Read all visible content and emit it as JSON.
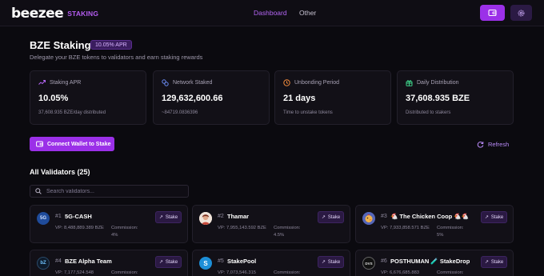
{
  "header": {
    "logo_text": "beezee",
    "logo_tag": "STAKING",
    "nav": [
      "Dashboard",
      "Other"
    ],
    "accent_color": "#9b30e8",
    "wallet_icon": "wallet-icon",
    "settings_icon": "gear-icon"
  },
  "page": {
    "title": "BZE Staking",
    "apr_badge": "10.05% APR",
    "subtitle": "Delegate your BZE tokens to validators and earn staking rewards"
  },
  "stats": [
    {
      "icon": "trending-up-icon",
      "label": "Staking APR",
      "value": "10.05%",
      "foot": "37,608.935 BZE/day distributed"
    },
    {
      "icon": "network-icon",
      "label": "Network Staked",
      "value": "129,632,600.66",
      "foot": "~84719.0836396"
    },
    {
      "icon": "clock-icon",
      "label": "Unbonding Period",
      "value": "21 days",
      "foot": "Time to unstake tokens"
    },
    {
      "icon": "gift-icon",
      "label": "Daily Distribution",
      "value": "37,608.935 BZE",
      "foot": "Distributed to stakers"
    }
  ],
  "actions": {
    "connect_label": "Connect Wallet to Stake",
    "refresh_label": "Refresh"
  },
  "validators": {
    "heading": "All Validators (25)",
    "search_placeholder": "Search validators...",
    "stake_label": "Stake",
    "items": [
      {
        "rank": "#1",
        "name": "5G-CASH",
        "vp": "VP: 8,488,889.389 BZE",
        "commission_label": "Commission:",
        "commission": "4%",
        "avatar_text": "5G"
      },
      {
        "rank": "#2",
        "name": "Thamar",
        "vp": "VP: 7,955,143.592 BZE",
        "commission_label": "Commission:",
        "commission": "4.5%",
        "avatar_text": ""
      },
      {
        "rank": "#3",
        "name": "🐔 The Chicken Coop 🐔🐔",
        "vp": "VP: 7,933,858.571 BZE",
        "commission_label": "Commission:",
        "commission": "5%",
        "avatar_text": ""
      },
      {
        "rank": "#4",
        "name": "BZE Alpha Team",
        "vp": "VP: 7,177,524.548",
        "commission_label": "Commission:",
        "commission": "",
        "avatar_text": "bZ"
      },
      {
        "rank": "#5",
        "name": "StakePool",
        "vp": "VP: 7,073,546.315",
        "commission_label": "Commission:",
        "commission": "",
        "avatar_text": "S"
      },
      {
        "rank": "#6",
        "name": "POSTHUMAN 🧪 StakeDrop",
        "vp": "VP: 6,676,685.883",
        "commission_label": "Commission:",
        "commission": "",
        "avatar_text": "DVS"
      }
    ]
  }
}
